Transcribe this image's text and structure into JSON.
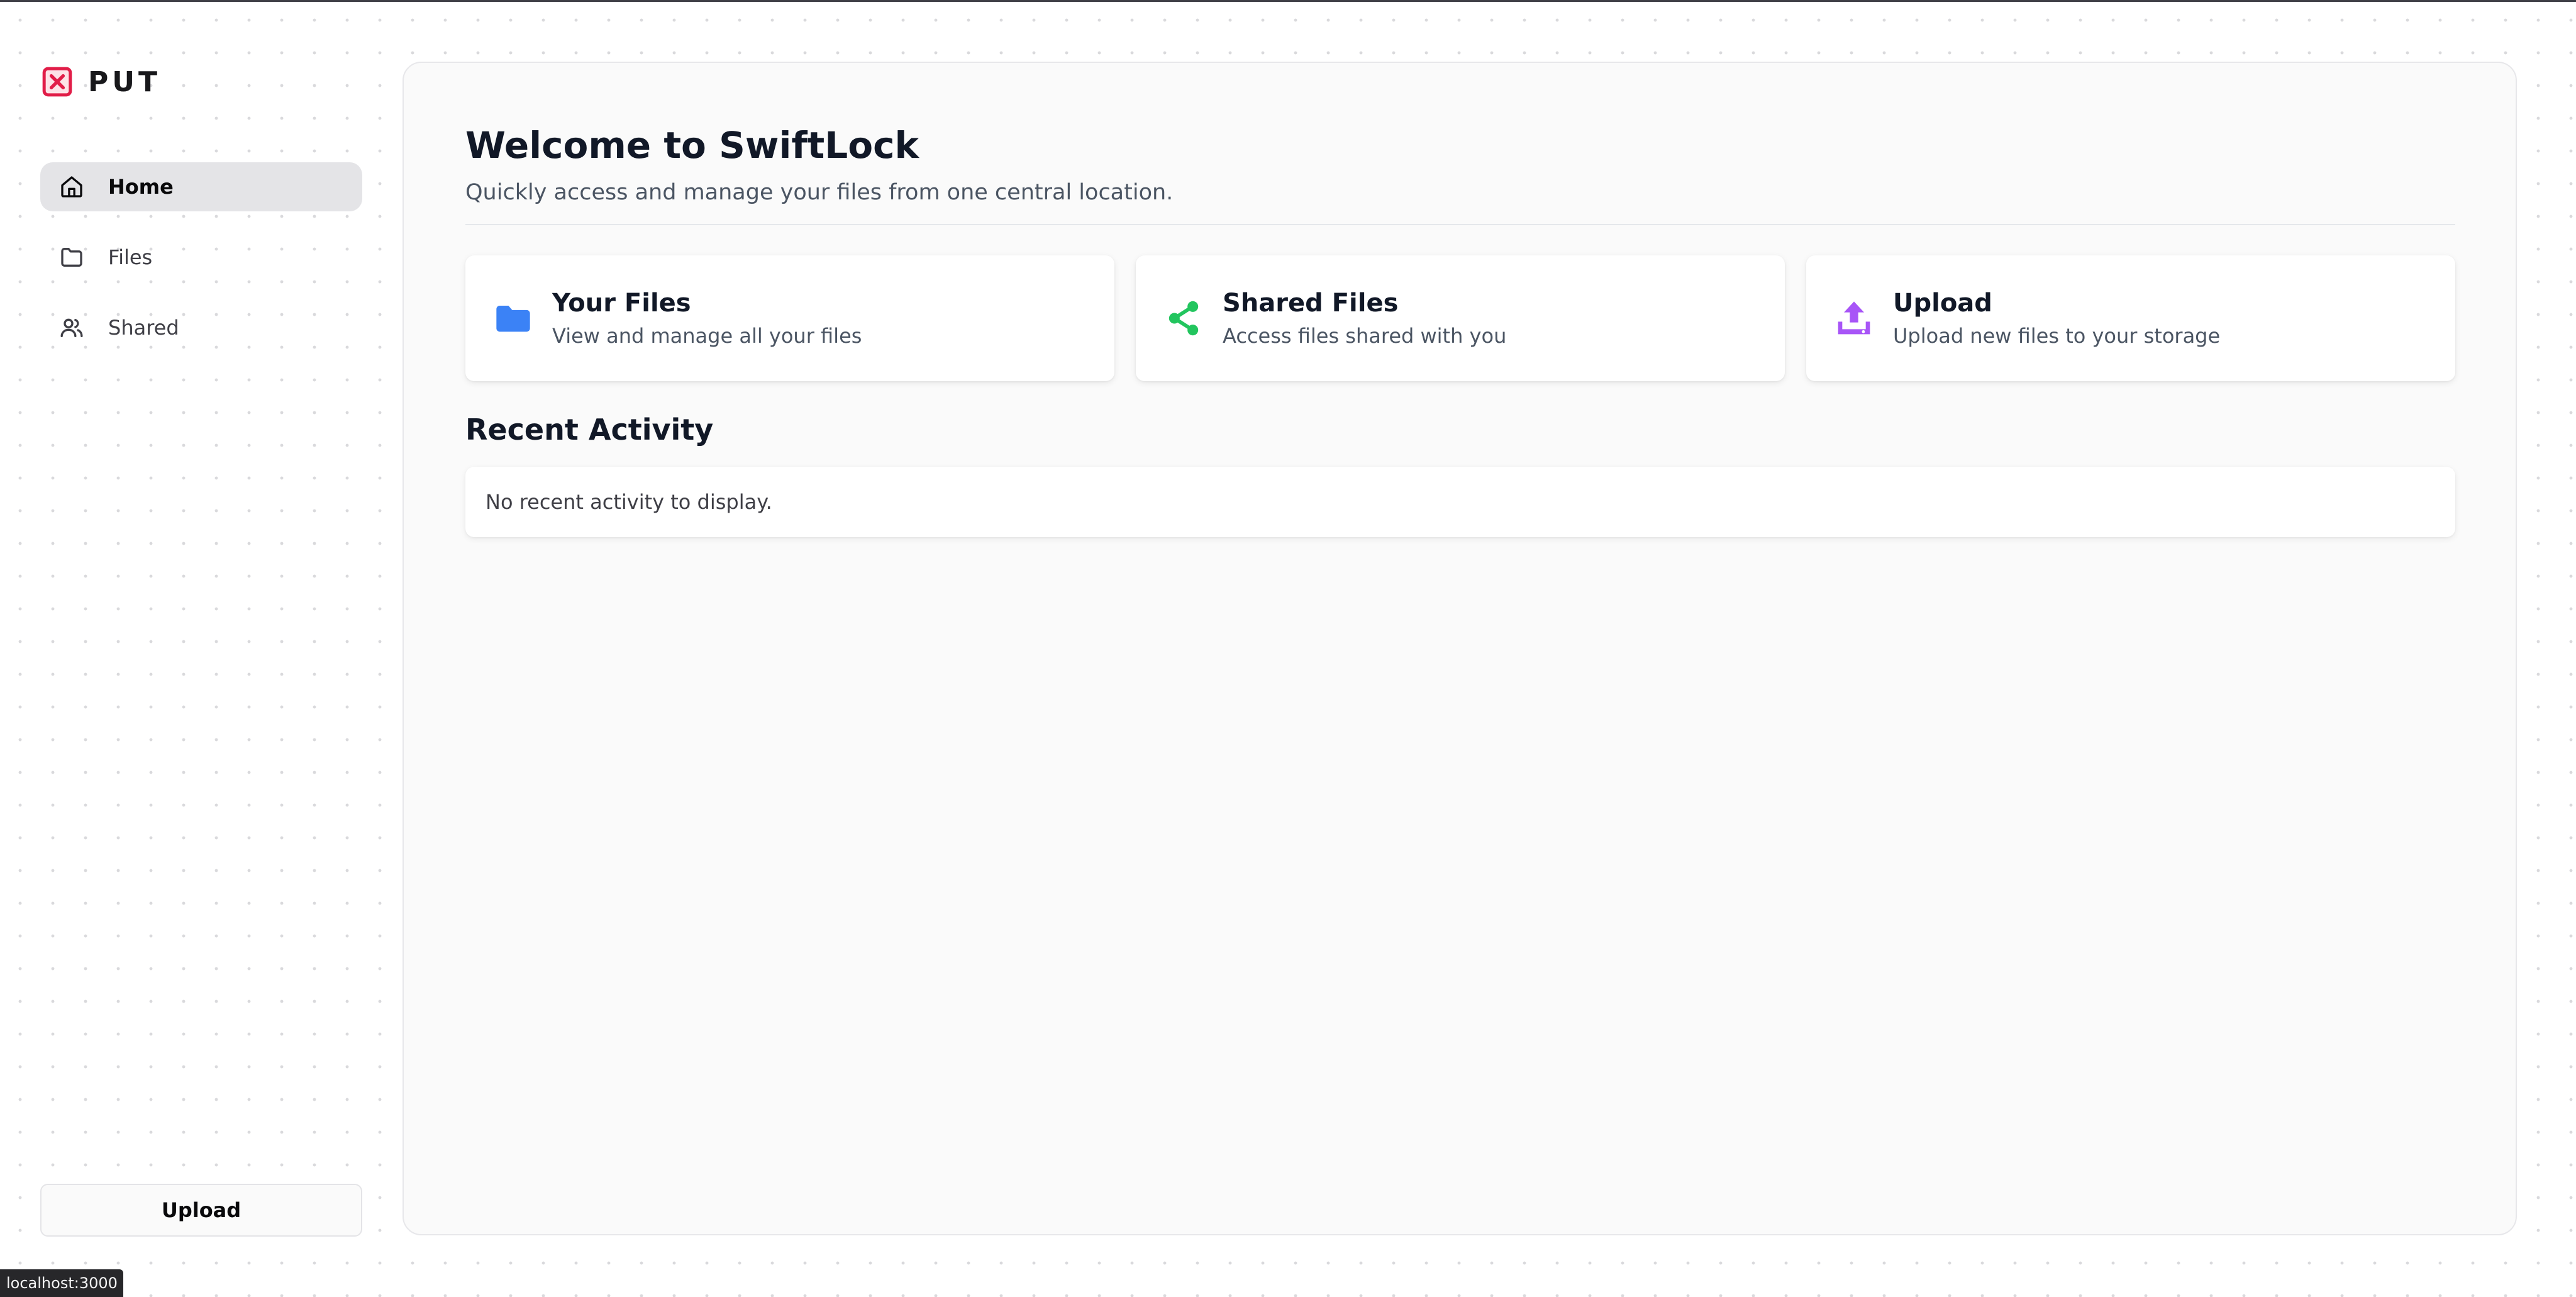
{
  "brand": {
    "name": "PUT",
    "icon": "x-square-icon",
    "accent": "#e11d48"
  },
  "sidebar": {
    "items": [
      {
        "label": "Home",
        "icon": "home-icon",
        "active": true
      },
      {
        "label": "Files",
        "icon": "folder-icon",
        "active": false
      },
      {
        "label": "Shared",
        "icon": "users-icon",
        "active": false
      }
    ],
    "upload_label": "Upload"
  },
  "main": {
    "title": "Welcome to SwiftLock",
    "subtitle": "Quickly access and manage your files from one central location.",
    "cards": [
      {
        "title": "Your Files",
        "description": "View and manage all your files",
        "icon": "folder-icon",
        "color": "#3b82f6"
      },
      {
        "title": "Shared Files",
        "description": "Access files shared with you",
        "icon": "share-icon",
        "color": "#22c55e"
      },
      {
        "title": "Upload",
        "description": "Upload new files to your storage",
        "icon": "upload-icon",
        "color": "#a855f7"
      }
    ],
    "recent_activity": {
      "title": "Recent Activity",
      "empty_text": "No recent activity to display."
    }
  },
  "status_bar": {
    "url": "localhost:3000"
  }
}
